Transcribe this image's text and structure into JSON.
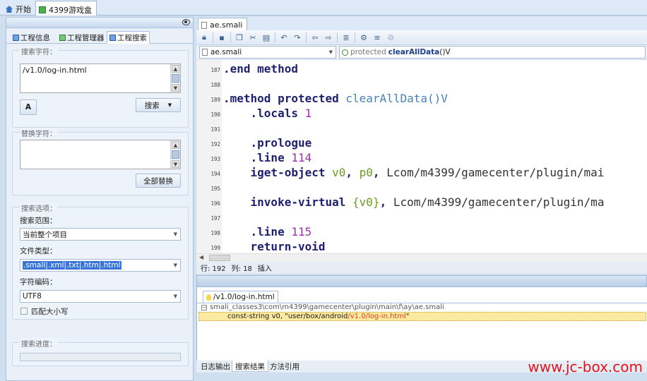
{
  "top_tabs": [
    {
      "label": "开始"
    },
    {
      "label": "4399游戏盒"
    }
  ],
  "left_panel": {
    "tabs": [
      "工程信息",
      "工程管理器",
      "工程搜索"
    ],
    "search_group_label": "搜索字符：",
    "search_value": "/v1.0/log-in.html",
    "search_button": "搜索",
    "replace_group_label": "替换字符：",
    "replace_value": "",
    "replace_all_button": "全部替换",
    "options_group_label": "搜索选项：",
    "scope_label": "搜索范围：",
    "scope_value": "当前整个项目",
    "filetype_label": "文件类型：",
    "filetype_value": ".smali|.xml|.txt|.htm|.html",
    "encoding_label": "字符编码：",
    "encoding_value": "UTF8",
    "match_case_label": "匹配大小写",
    "progress_label": "搜索进度："
  },
  "editor": {
    "tab_label": "ae.smali",
    "file_combo": "ae.smali",
    "method_combo_prefix": "protected",
    "method_combo_name": "clearAllData",
    "method_combo_sig": "()V",
    "lines": [
      {
        "n": "187",
        "text": ".end method"
      },
      {
        "n": "188",
        "text": ""
      },
      {
        "n": "189",
        "text": ".method protected clearAllData()V"
      },
      {
        "n": "190",
        "text": "    .locals 1"
      },
      {
        "n": "191",
        "text": ""
      },
      {
        "n": "192",
        "text": "    .prologue"
      },
      {
        "n": "193",
        "text": "    .line 114"
      },
      {
        "n": "194",
        "text": "    iget-object v0, p0, Lcom/m4399/gamecenter/plugin/mai"
      },
      {
        "n": "195",
        "text": ""
      },
      {
        "n": "196",
        "text": "    invoke-virtual {v0}, Lcom/m4399/gamecenter/plugin/ma"
      },
      {
        "n": "197",
        "text": ""
      },
      {
        "n": "198",
        "text": "    .line 115"
      },
      {
        "n": "199",
        "text": "    return-void"
      }
    ],
    "status_row": "行: 192",
    "status_col": "列: 18",
    "status_mode": "插入"
  },
  "results": {
    "tab_label": "/v1.0/log-in.html",
    "file_path": "smali_classes3\\com\\m4399\\gamecenter\\plugin\\main\\f\\ay\\ae.smali",
    "match_prefix": "const-string v0, \"user/box/android",
    "match_hit": "/v1.0/log-in.html",
    "match_suffix": "\""
  },
  "bottom_tabs": [
    "日志输出",
    "搜索结果",
    "方法引用"
  ],
  "watermark": "www.jc-box.com"
}
